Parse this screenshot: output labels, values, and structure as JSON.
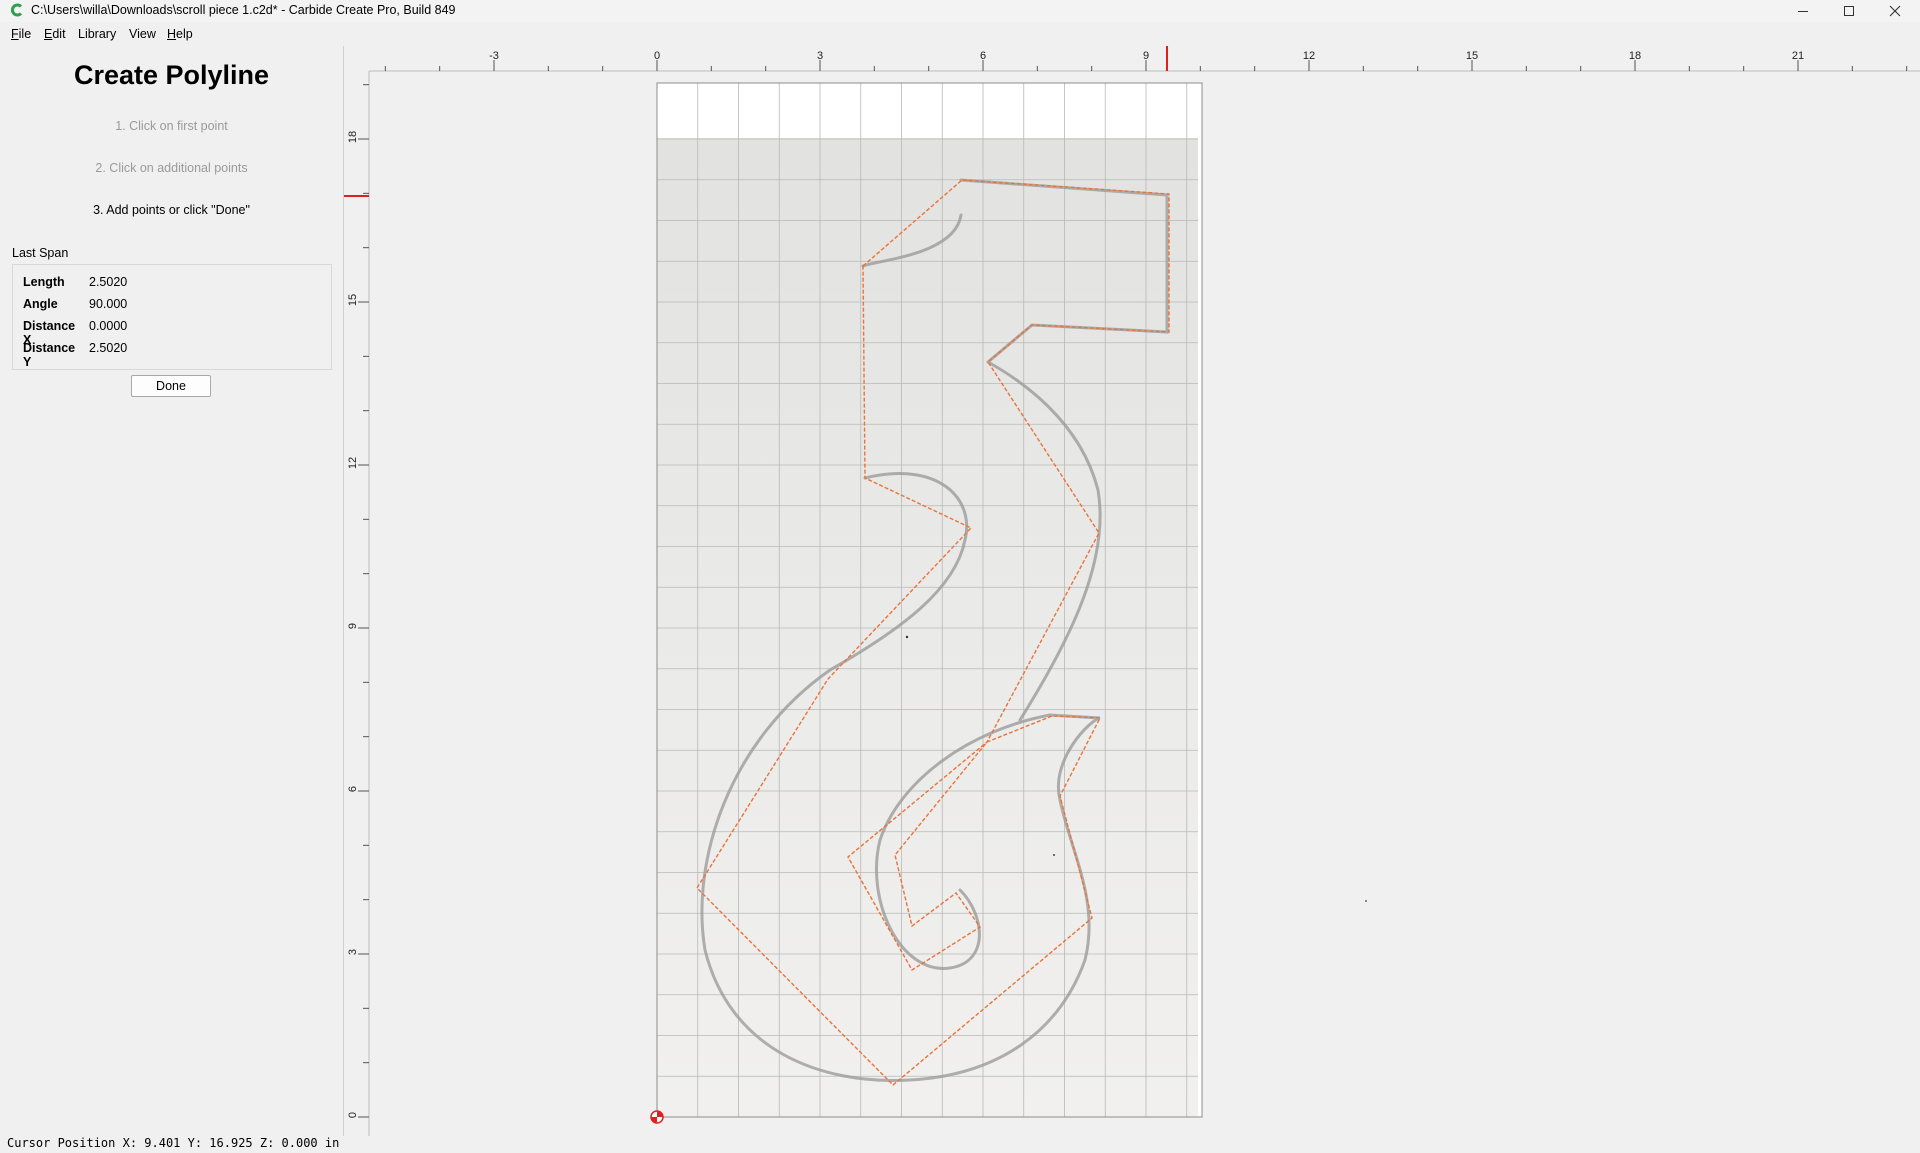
{
  "window": {
    "title": "C:\\Users\\willa\\Downloads\\scroll piece 1.c2d* - Carbide Create Pro, Build 849",
    "accent": "#2e9e4f"
  },
  "menu": {
    "file": {
      "u": "F",
      "rest": "ile"
    },
    "edit": {
      "u": "E",
      "rest": "dit"
    },
    "library": {
      "u": "",
      "rest": "Library"
    },
    "view": {
      "u": "",
      "rest": "View"
    },
    "help": {
      "u": "H",
      "rest": "elp"
    }
  },
  "panel": {
    "title": "Create Polyline",
    "steps": [
      "1. Click on first point",
      "2. Click on additional points",
      "3. Add points or click \"Done\""
    ],
    "last_span_label": "Last Span",
    "span": [
      {
        "key": "Length",
        "value": "2.5020"
      },
      {
        "key": "Angle",
        "value": "90.000"
      },
      {
        "key": "Distance X",
        "value": "0.0000"
      },
      {
        "key": "Distance Y",
        "value": "2.5020"
      }
    ],
    "done_label": "Done"
  },
  "ruler": {
    "x_labels": [
      "-3",
      "0",
      "3",
      "6",
      "9",
      "12",
      "15",
      "18",
      "21"
    ],
    "y_labels": [
      "18",
      "15",
      "12",
      "9",
      "6",
      "3",
      "0"
    ],
    "marker_color": "#e02020"
  },
  "drawing": {
    "path_color": "#e8743b",
    "sketch_color": "#9c9c9c"
  },
  "status": {
    "cursor": "Cursor Position X: 9.401 Y: 16.925 Z: 0.000 in"
  }
}
